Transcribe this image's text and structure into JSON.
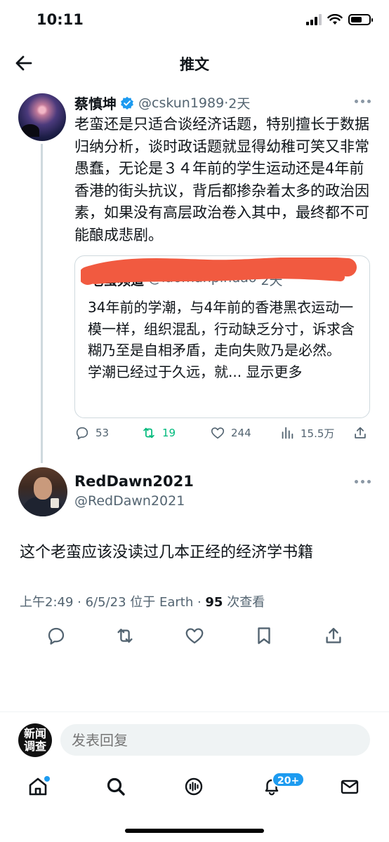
{
  "status_bar": {
    "time": "10:11"
  },
  "header": {
    "title": "推文"
  },
  "parent_tweet": {
    "name": "蔡慎坤",
    "handle": "@cskun1989",
    "separator": "·",
    "age": "2天",
    "body": "老蛮还是只适合谈经济话题，特别擅长于数据归纳分析，谈时政话题就显得幼稚可笑又非常愚蠢，无论是３４年前的学生运动还是4年前香港的街头抗议，背后都掺杂着太多的政治因素，如果没有高层政治卷入其中，最终都不可能酿成悲剧。",
    "quote": {
      "name": "老蛮频道",
      "handle": "@laomanpindao",
      "age": "2天",
      "body": "34年前的学潮，与4年前的香港黑衣运动一模一样，组织混乱，行动缺乏分寸，诉求含糊乃至是自相矛盾，走向失败乃是必然。",
      "body2": "学潮已经过于久远，就...",
      "more_label": "显示更多"
    },
    "actions": {
      "replies": "53",
      "retweets": "19",
      "likes": "244",
      "views": "15.5万"
    }
  },
  "main_tweet": {
    "name": "RedDawn2021",
    "handle": "@RedDawn2021",
    "body": "这个老蛮应该没读过几本正经的经济学书籍",
    "meta_prefix": "上午2:49 · 6/5/23 位于 Earth · ",
    "views_count": "95",
    "meta_suffix": " 次查看"
  },
  "reply_bar": {
    "avatar_text_1": "新闻",
    "avatar_text_2": "调查",
    "placeholder": "发表回复"
  },
  "tab_bar": {
    "notifications_badge": "20+",
    "icons": [
      "home-icon",
      "search-icon",
      "spaces-icon",
      "bell-icon",
      "mail-icon"
    ]
  },
  "colors": {
    "accent": "#1d9bf0",
    "retweet_active": "#00ba7c",
    "secondary_text": "#536471",
    "redaction": "#f15a40"
  }
}
